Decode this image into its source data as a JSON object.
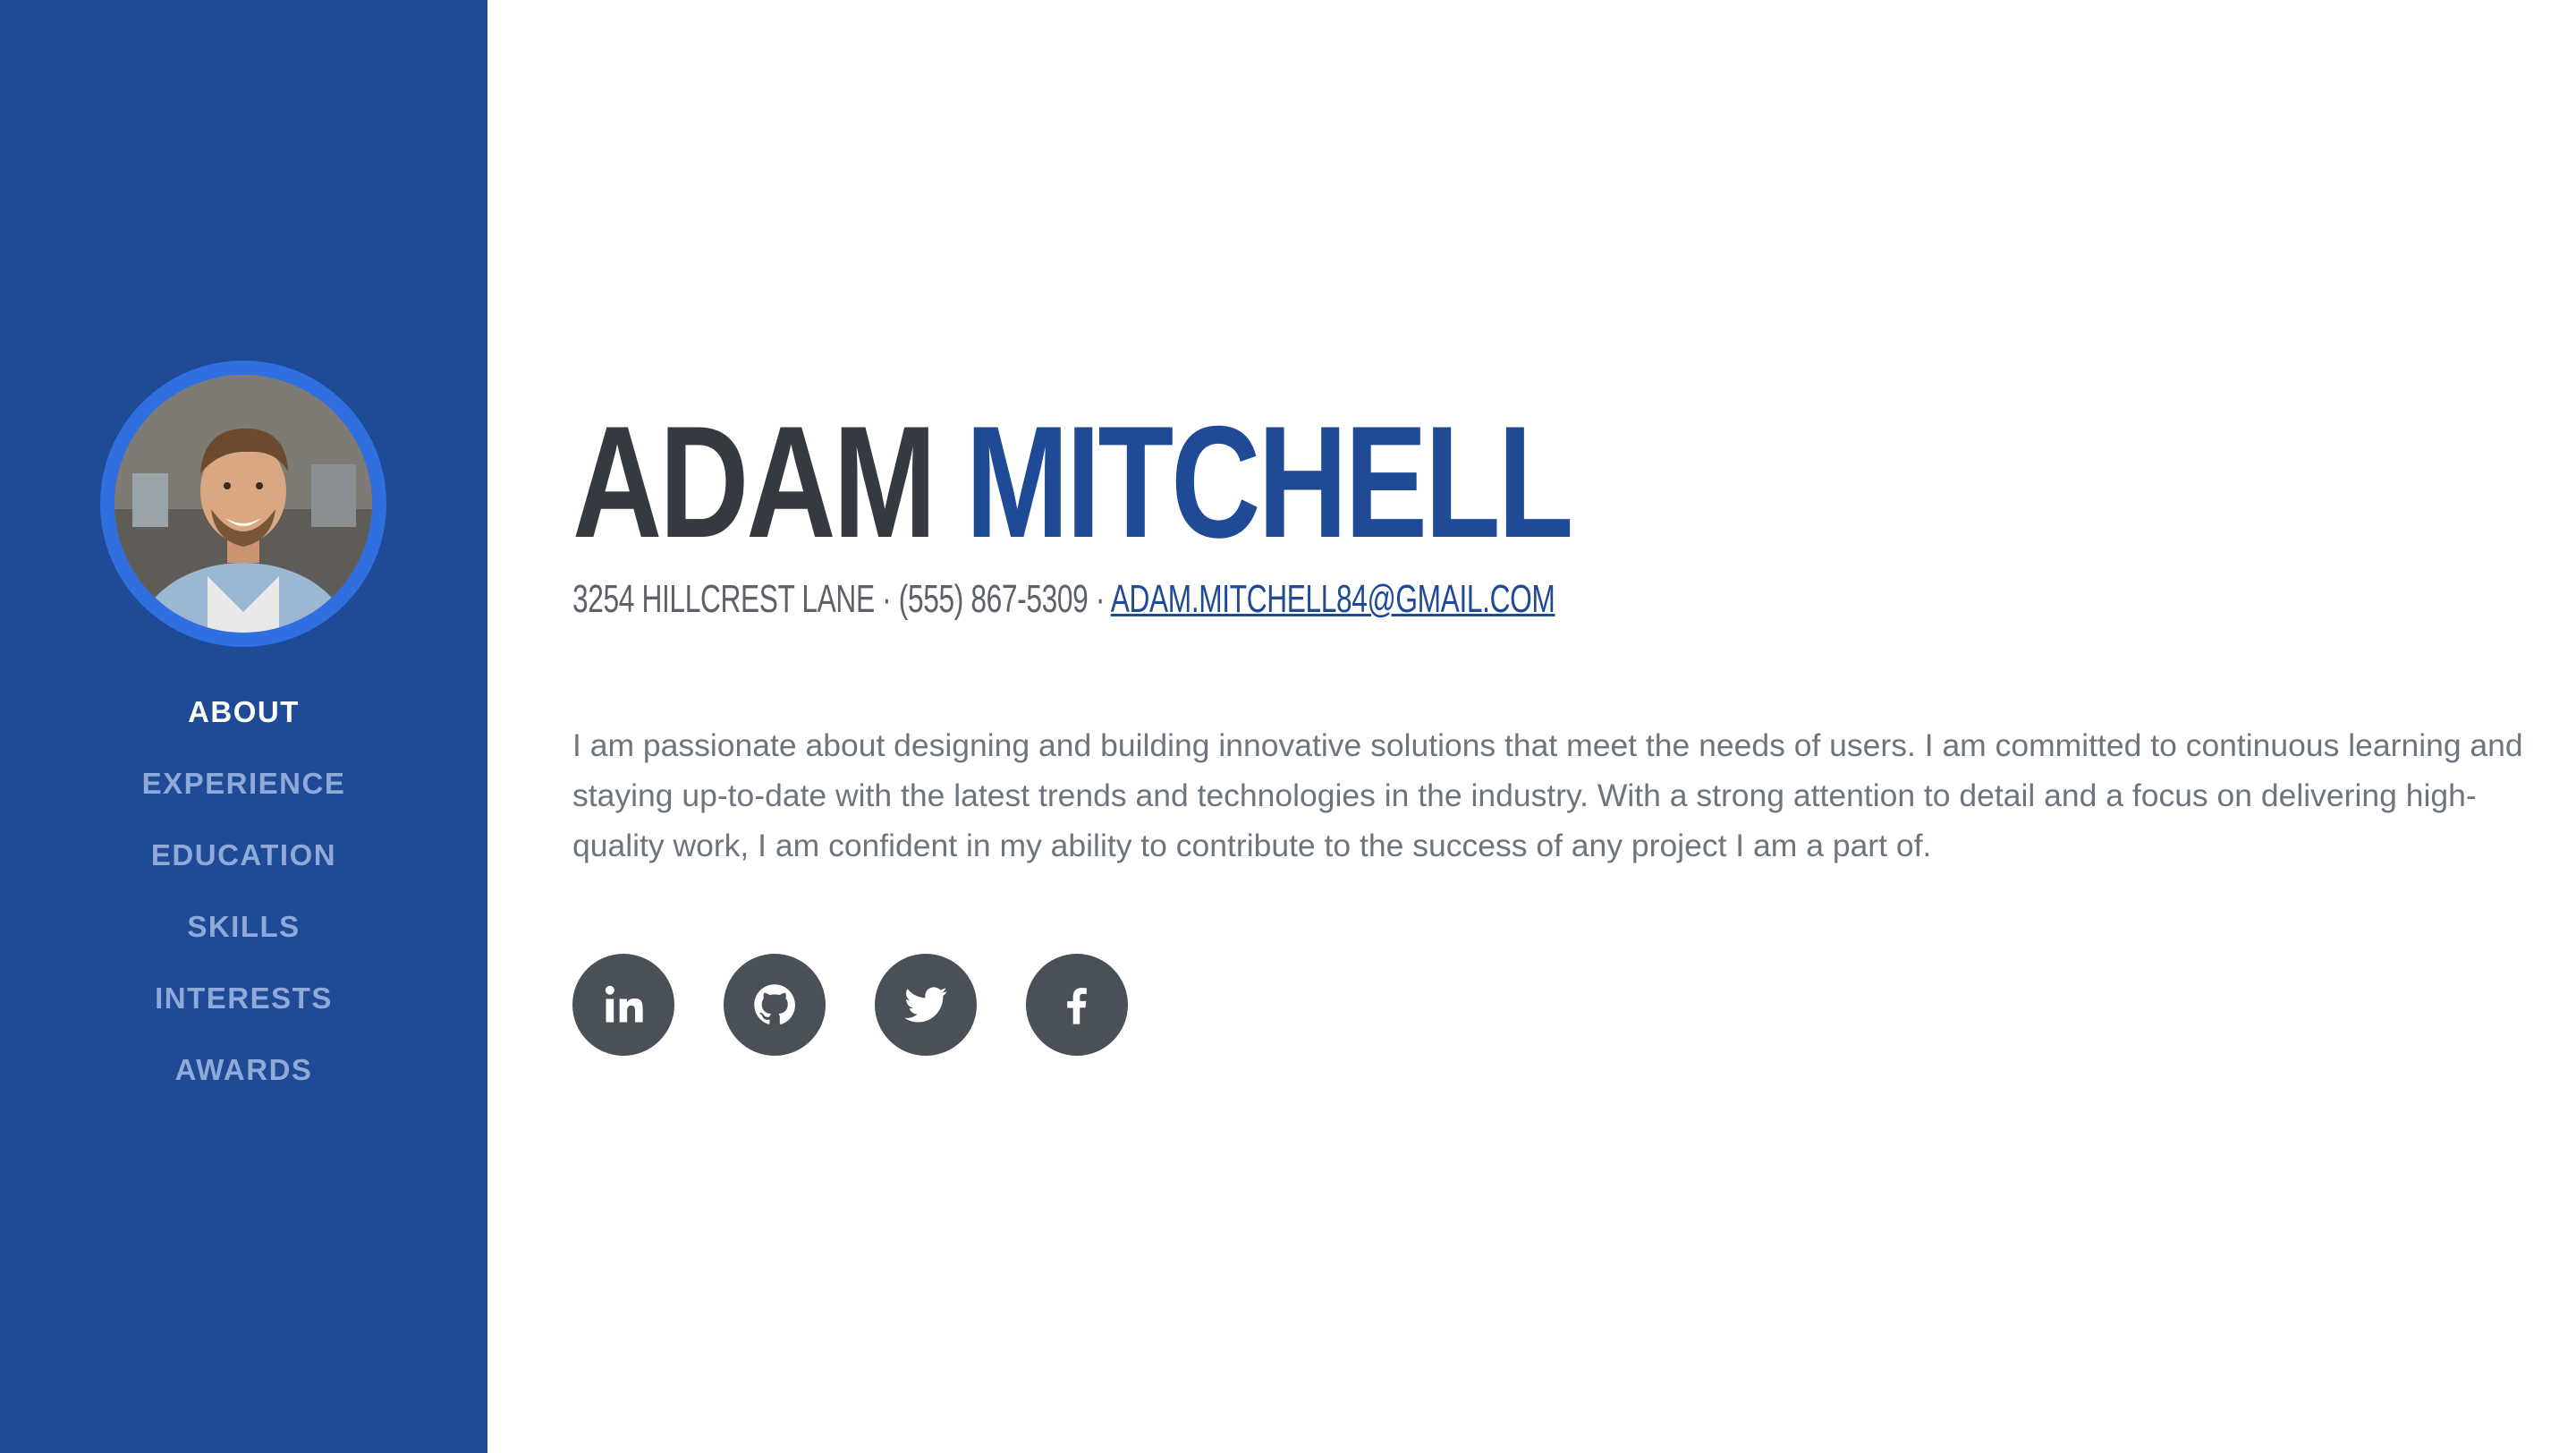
{
  "sidebar": {
    "nav": [
      {
        "label": "ABOUT",
        "active": true
      },
      {
        "label": "EXPERIENCE",
        "active": false
      },
      {
        "label": "EDUCATION",
        "active": false
      },
      {
        "label": "SKILLS",
        "active": false
      },
      {
        "label": "INTERESTS",
        "active": false
      },
      {
        "label": "AWARDS",
        "active": false
      }
    ]
  },
  "profile": {
    "first_name": "ADAM",
    "last_name": "MITCHELL",
    "address": "3254 HILLCREST LANE",
    "separator": " · ",
    "phone": "(555) 867-5309",
    "email": "ADAM.MITCHELL84@GMAIL.COM",
    "bio": "I am passionate about designing and building innovative solutions that meet the needs of users. I am committed to continuous learning and staying up-to-date with the latest trends and technologies in the industry. With a strong attention to detail and a focus on delivering high-quality work, I am confident in my ability to contribute to the success of any project I am a part of."
  },
  "socials": [
    {
      "icon": "linkedin-icon"
    },
    {
      "icon": "github-icon"
    },
    {
      "icon": "twitter-icon"
    },
    {
      "icon": "facebook-icon"
    }
  ],
  "colors": {
    "sidebar_bg": "#1e4a96",
    "avatar_ring": "#2f6fe0",
    "name_first": "#343a40",
    "name_last": "#1e4a96",
    "nav_active": "#ffffff",
    "nav_inactive": "#8fa9d8",
    "social_bg": "#495057",
    "body_text": "#6c757d"
  }
}
